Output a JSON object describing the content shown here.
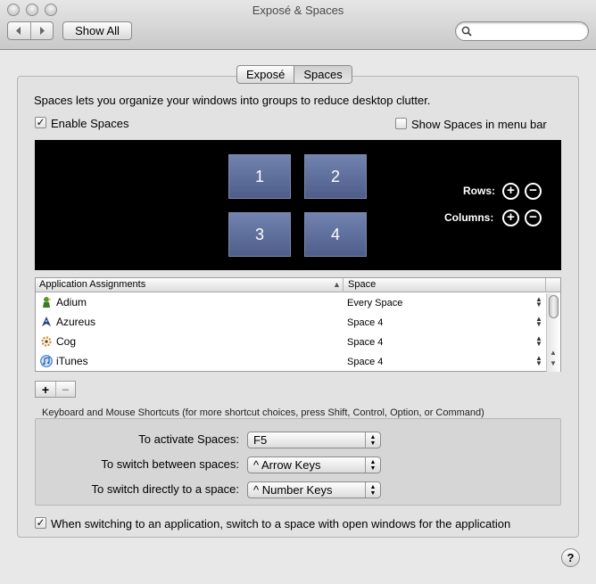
{
  "window": {
    "title": "Exposé & Spaces"
  },
  "toolbar": {
    "back_icon": "chevron-left",
    "forward_icon": "chevron-right",
    "show_all_label": "Show All",
    "search_placeholder": ""
  },
  "tabs": [
    {
      "label": "Exposé",
      "selected": false
    },
    {
      "label": "Spaces",
      "selected": true
    }
  ],
  "spaces": {
    "intro": "Spaces lets you organize your windows into groups to reduce desktop clutter.",
    "enable_label": "Enable Spaces",
    "enable_checked": true,
    "menubar_label": "Show Spaces in menu bar",
    "menubar_checked": false,
    "grid": [
      "1",
      "2",
      "3",
      "4"
    ],
    "rows_label": "Rows:",
    "columns_label": "Columns:"
  },
  "assignments": {
    "headers": {
      "app": "Application Assignments",
      "space": "Space"
    },
    "rows": [
      {
        "app": "Adium",
        "space": "Every Space",
        "icon": "adium-duck-icon",
        "color": "#3a8a2a"
      },
      {
        "app": "Azureus",
        "space": "Space 4",
        "icon": "azureus-frog-icon",
        "color": "#2d3d78"
      },
      {
        "app": "Cog",
        "space": "Space 4",
        "icon": "cog-icon",
        "color": "#c9862c"
      },
      {
        "app": "iTunes",
        "space": "Space 4",
        "icon": "itunes-icon",
        "color": "#3a7ed8"
      }
    ]
  },
  "shortcuts": {
    "title": "Keyboard and Mouse Shortcuts (for more shortcut choices, press Shift, Control, Option, or Command)",
    "items": [
      {
        "label": "To activate Spaces:",
        "value": "F5"
      },
      {
        "label": "To switch between spaces:",
        "value": "^ Arrow Keys"
      },
      {
        "label": "To switch directly to a space:",
        "value": "^ Number Keys"
      }
    ]
  },
  "follow_app": {
    "label": "When switching to an application, switch to a space with open windows for the application",
    "checked": true
  },
  "help_label": "?",
  "colors": {
    "space_tile": "#5d6d9b",
    "preview_bg": "#000000"
  }
}
